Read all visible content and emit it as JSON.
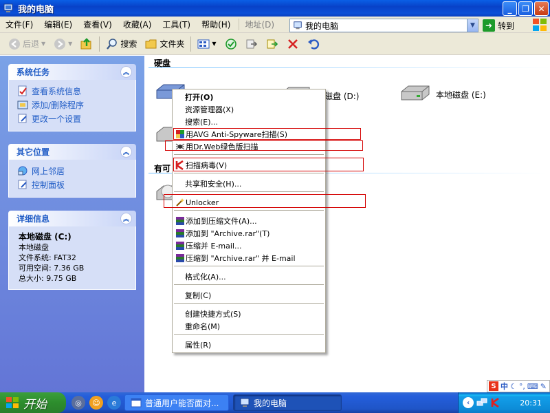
{
  "window": {
    "title": "我的电脑"
  },
  "menubar": {
    "items": [
      {
        "label": "文件(F)"
      },
      {
        "label": "编辑(E)"
      },
      {
        "label": "查看(V)"
      },
      {
        "label": "收藏(A)"
      },
      {
        "label": "工具(T)"
      },
      {
        "label": "帮助(H)"
      }
    ],
    "address_label": "地址(D)",
    "address_value": "我的电脑",
    "goto_label": "转到"
  },
  "toolbar": {
    "back_label": "后退",
    "search_label": "搜索",
    "folders_label": "文件夹"
  },
  "sidebar": {
    "system_tasks": {
      "title": "系统任务",
      "items": [
        {
          "label": "查看系统信息"
        },
        {
          "label": "添加/删除程序"
        },
        {
          "label": "更改一个设置"
        }
      ]
    },
    "other_places": {
      "title": "其它位置",
      "items": [
        {
          "label": "网上邻居"
        },
        {
          "label": "控制面板"
        }
      ]
    },
    "details": {
      "title": "详细信息",
      "name": "本地磁盘 (C:)",
      "type": "本地磁盘",
      "filesystem": "文件系统: FAT32",
      "free": "可用空间: 7.36 GB",
      "total": "总大小: 9.75 GB"
    }
  },
  "main": {
    "group_harddisk": "硬盘",
    "group_removable": "有可",
    "drive_d": "地磁盘 (D:)",
    "drive_e": "本地磁盘 (E:)"
  },
  "context_menu": {
    "items": [
      {
        "label": "打开(O)"
      },
      {
        "label": "资源管理器(X)"
      },
      {
        "label": "搜索(E)..."
      },
      {
        "label": "用AVG Anti-Spyware扫描(S)"
      },
      {
        "label": "用Dr.Web绿色版扫描"
      },
      {
        "label": "扫描病毒(V)"
      },
      {
        "label": "共享和安全(H)..."
      },
      {
        "label": "Unlocker"
      },
      {
        "label": "添加到压缩文件(A)..."
      },
      {
        "label": "添加到 \"Archive.rar\"(T)"
      },
      {
        "label": "压缩并 E-mail..."
      },
      {
        "label": "压缩到 \"Archive.rar\" 并 E-mail"
      },
      {
        "label": "格式化(A)..."
      },
      {
        "label": "复制(C)"
      },
      {
        "label": "创建快捷方式(S)"
      },
      {
        "label": "重命名(M)"
      },
      {
        "label": "属性(R)"
      }
    ]
  },
  "imebar": {
    "text": "中"
  },
  "taskbar": {
    "start_label": "开始",
    "tasks": [
      {
        "label": "普通用户能否面对..."
      },
      {
        "label": "我的电脑"
      }
    ],
    "clock": "20:31"
  },
  "colors": {
    "titlebar": "#0a5fe6",
    "taskpane_link": "#215dc6",
    "highlight_box": "#d40000"
  }
}
